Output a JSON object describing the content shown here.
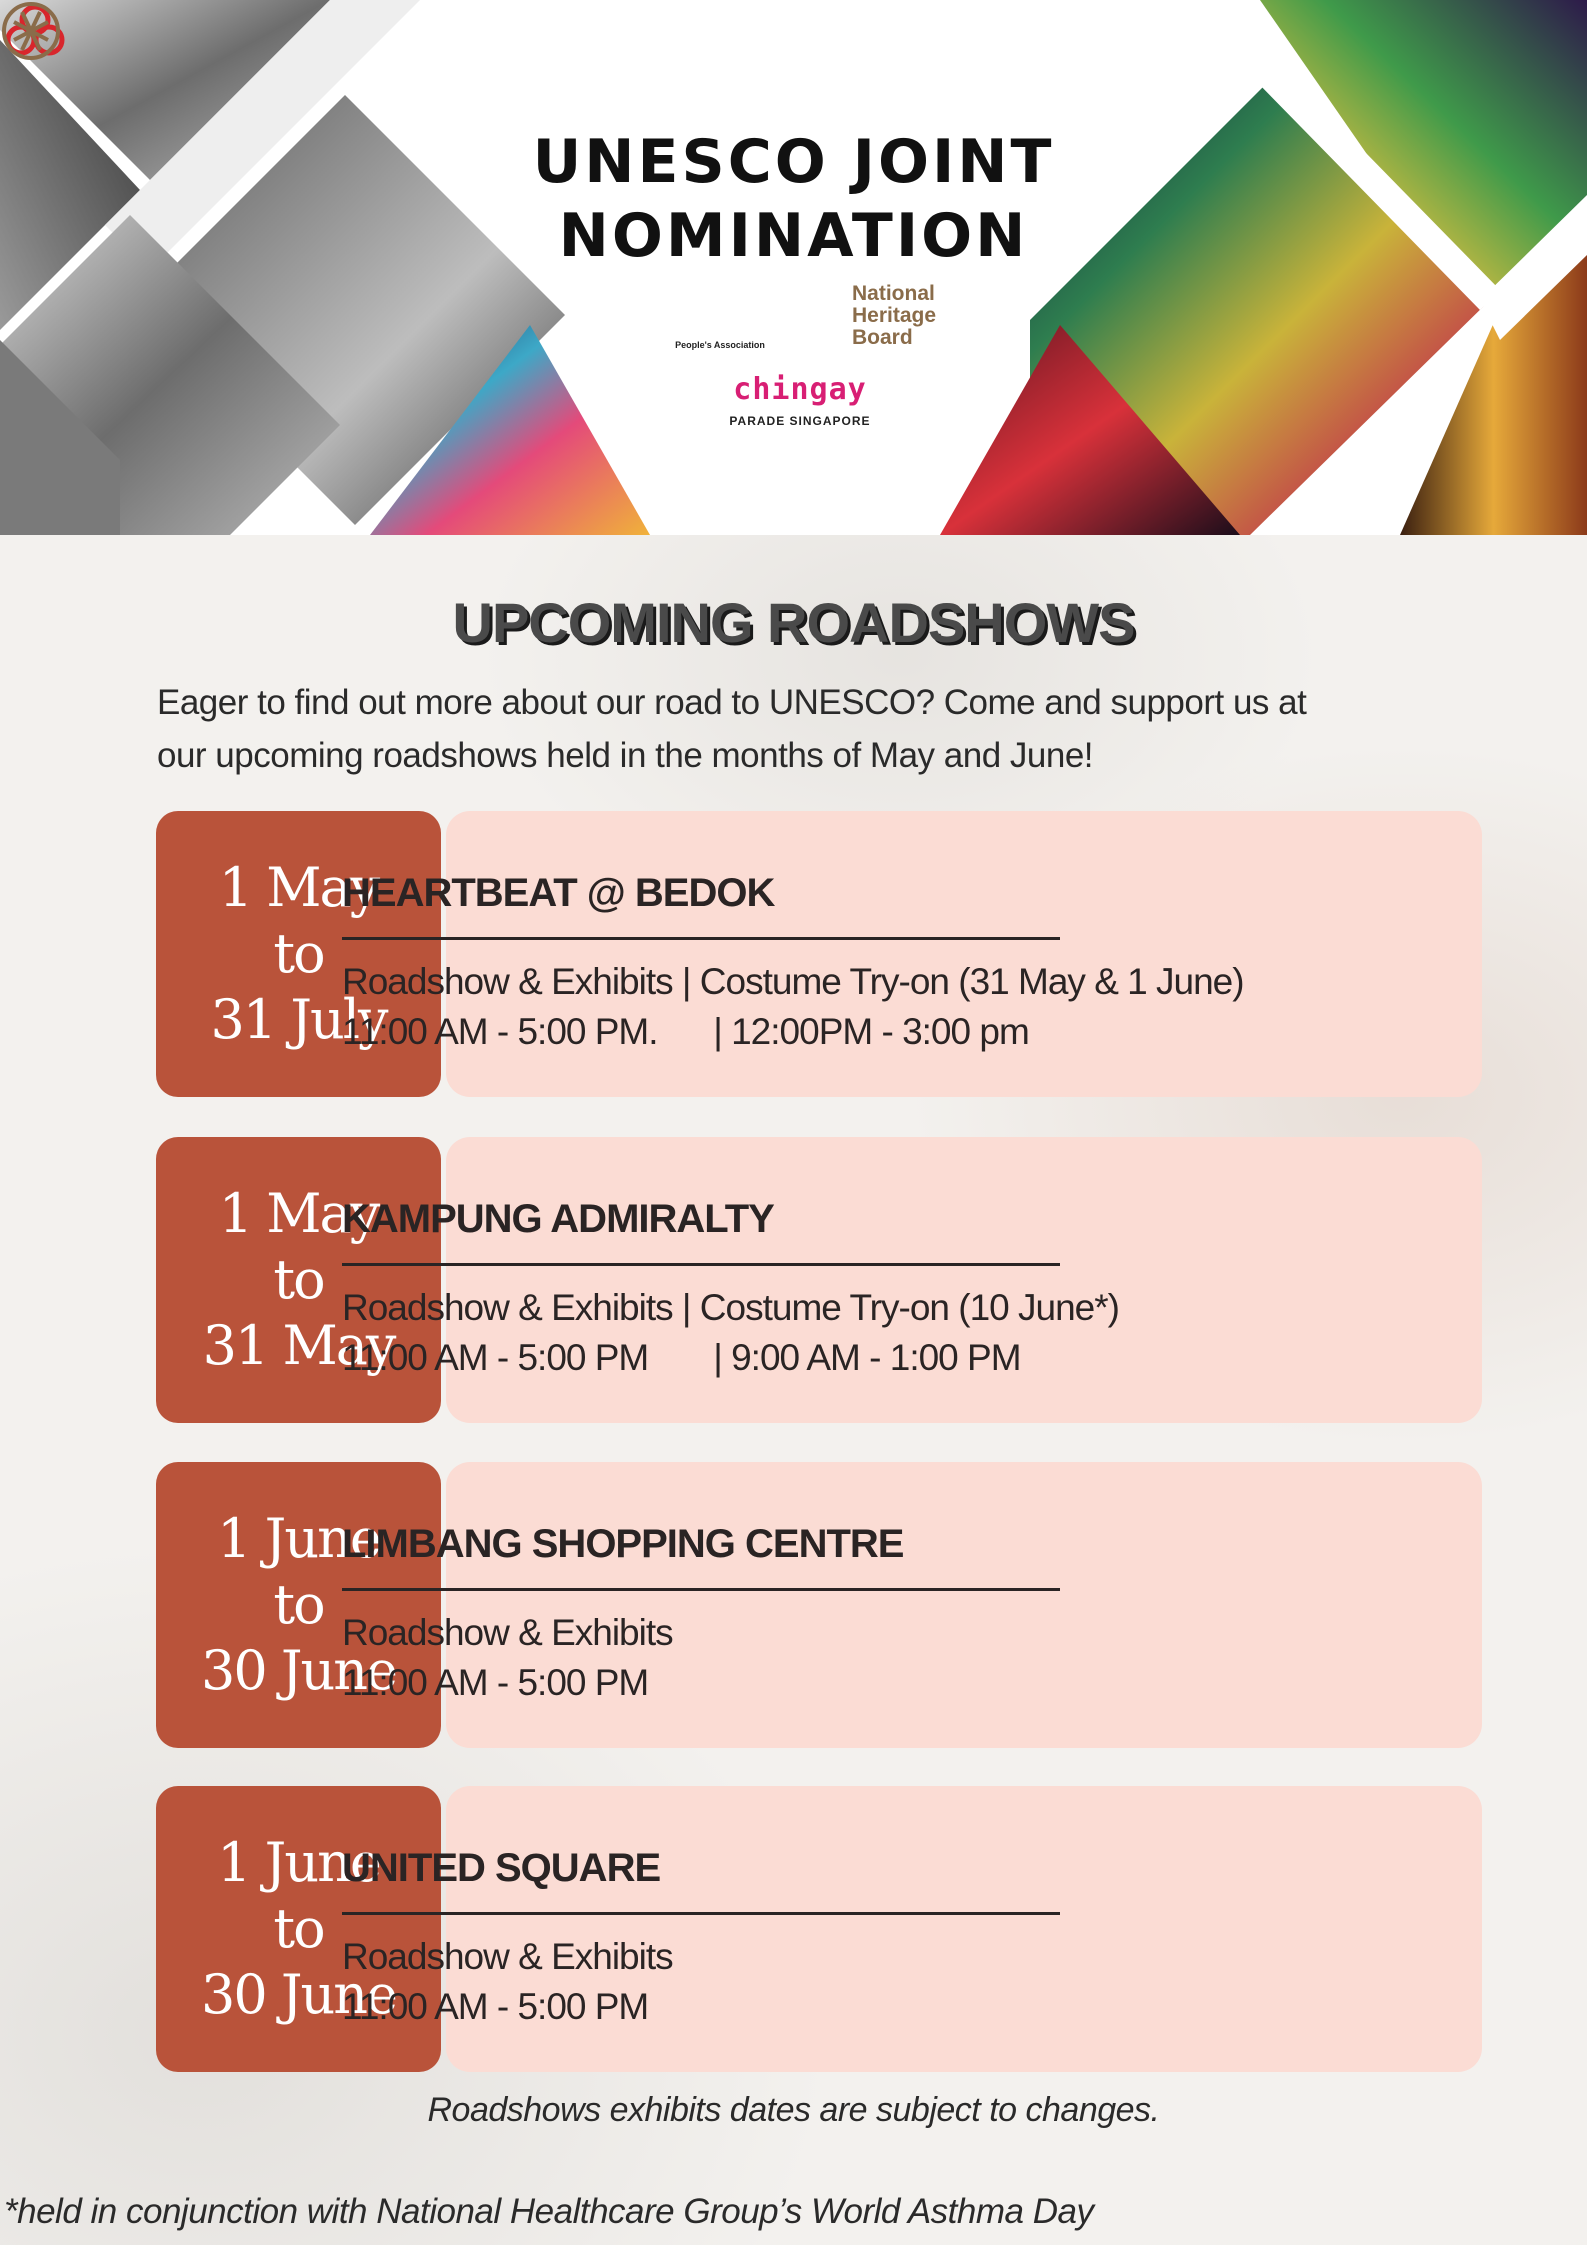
{
  "header": {
    "title_line1": "UNESCO JOINT",
    "title_line2": "NOMINATION",
    "logos": {
      "peoples_association": "People's Association",
      "nhb_line1": "National",
      "nhb_line2": "Heritage",
      "nhb_line3": "Board",
      "chingay": "chingay",
      "chingay_sub": "PARADE SINGAPORE"
    }
  },
  "section": {
    "title": "UPCOMING ROADSHOWS",
    "intro_line1": "Eager to find out more about our road to UNESCO? Come and support us at",
    "intro_line2": "our upcoming roadshows held in the months of May and June!"
  },
  "events": [
    {
      "date_start": "1 May",
      "date_to": "to",
      "date_end": "31 July",
      "venue": "HEARTBEAT @ BEDOK",
      "line1": "Roadshow & Exhibits | Costume Try-on (31 May & 1 June)",
      "line2": "11:00 AM - 5:00 PM.      | 12:00PM - 3:00 pm"
    },
    {
      "date_start": "1 May",
      "date_to": "to",
      "date_end": "31 May",
      "venue": "KAMPUNG ADMIRALTY",
      "line1": "Roadshow & Exhibits | Costume Try-on (10 June*)",
      "line2": "11:00 AM - 5:00 PM       | 9:00 AM - 1:00 PM"
    },
    {
      "date_start": "1 June",
      "date_to": "to",
      "date_end": "30 June",
      "venue": "LIMBANG SHOPPING CENTRE",
      "line1": "Roadshow & Exhibits",
      "line2": "11:00 AM - 5:00 PM"
    },
    {
      "date_start": "1 June",
      "date_to": "to",
      "date_end": "30 June",
      "venue": "UNITED SQUARE",
      "line1": "Roadshow & Exhibits",
      "line2": "11:00 AM - 5:00 PM"
    }
  ],
  "note": "Roadshows exhibits dates are subject to changes.",
  "footnote": "*held in conjunction with National Healthcare Group’s World Asthma Day",
  "colors": {
    "date_box": "#b9533a",
    "info_box": "#fbdcd4",
    "chingay_pink": "#d81f74",
    "nhb_gold": "#8a6c4a",
    "pa_red": "#d8262c"
  }
}
